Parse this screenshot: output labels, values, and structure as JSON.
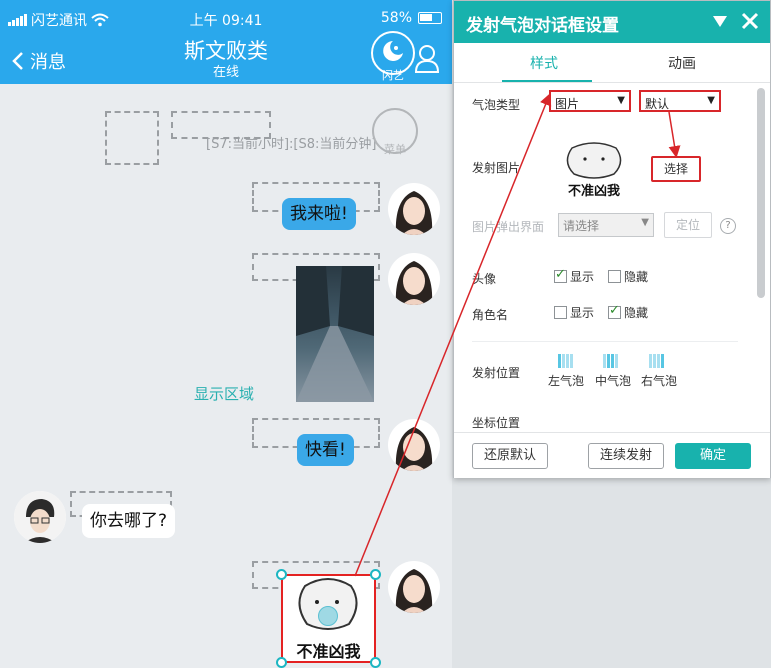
{
  "status_bar": {
    "carrier": "闪艺通讯",
    "time": "上午 09:41",
    "battery": "58%"
  },
  "nav": {
    "back_label": "消息",
    "title": "斯文败类",
    "subtitle": "在线",
    "logo_text": "闪艺"
  },
  "chat": {
    "system_text": "[S7:当前小时]:[S8:当前分钟]",
    "stamp_text": "菜单",
    "messages": [
      {
        "text": "我来啦!"
      },
      {
        "text": "快看!"
      },
      {
        "text": "你去哪了?"
      }
    ],
    "display_area_label": "显示区域",
    "sticker_caption": "不准凶我"
  },
  "dialog": {
    "title": "发射气泡对话框设置",
    "tabs": [
      {
        "label": "样式"
      },
      {
        "label": "动画"
      }
    ],
    "bubble_type": {
      "label": "气泡类型",
      "type_value": "图片",
      "style_value": "默认"
    },
    "emit_image": {
      "label": "发射图片",
      "sticker_caption": "不准凶我",
      "select_button": "选择"
    },
    "popup_screen": {
      "label": "图片弹出界面",
      "placeholder": "请选择",
      "locate_button": "定位",
      "help": "?"
    },
    "avatar": {
      "label": "头像",
      "show": "显示",
      "hide": "隐藏"
    },
    "role_name": {
      "label": "角色名",
      "show": "显示",
      "hide": "隐藏"
    },
    "emit_position": {
      "label": "发射位置",
      "options": [
        {
          "label": "左气泡"
        },
        {
          "label": "中气泡"
        },
        {
          "label": "右气泡"
        }
      ]
    },
    "coord_position": {
      "label": "坐标位置"
    },
    "footer": {
      "reset": "还原默认",
      "continuous": "连续发射",
      "confirm": "确定"
    }
  },
  "colors": {
    "accent": "#18b2ad",
    "phone_bar": "#2aa8ec",
    "highlight_red": "#d8262a"
  }
}
